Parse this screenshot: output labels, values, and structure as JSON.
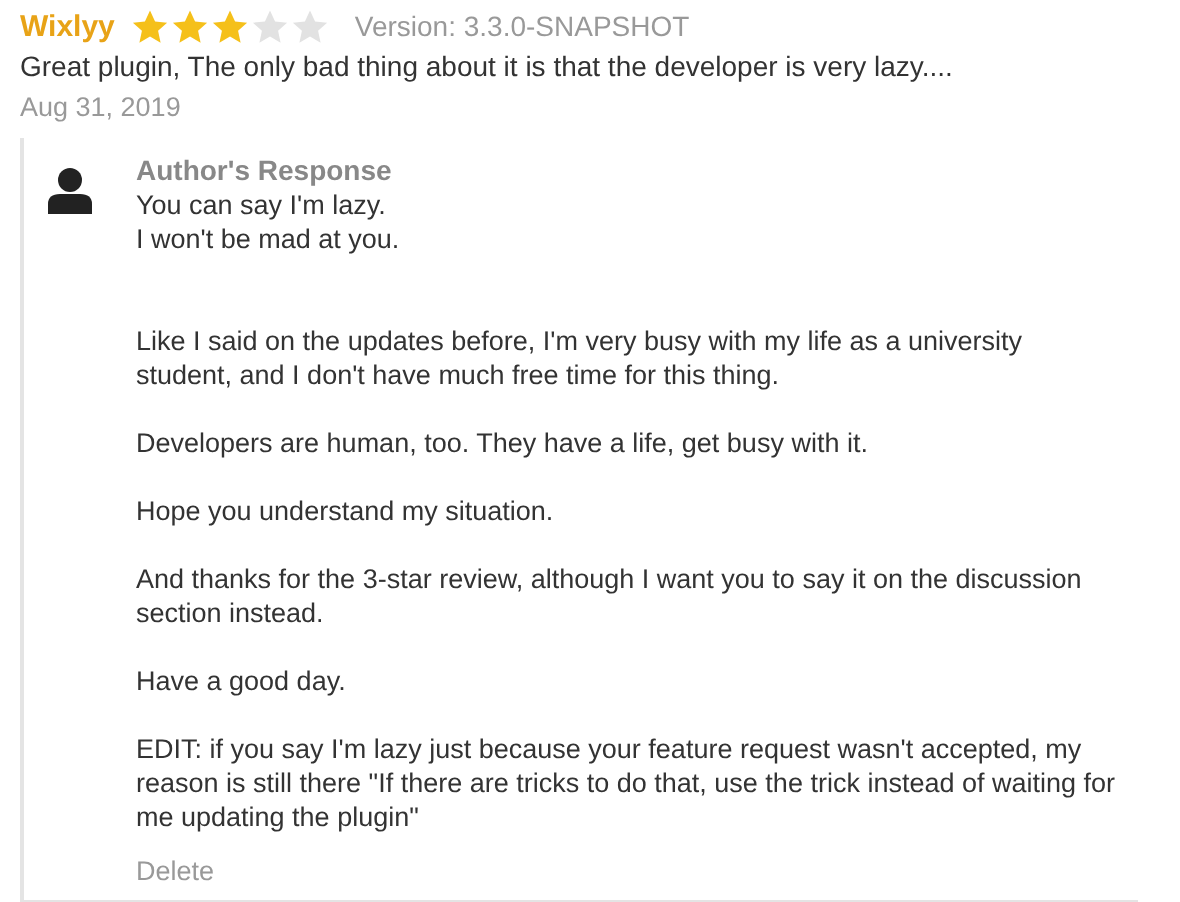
{
  "review": {
    "author": "Wixlyy",
    "stars": 3,
    "version": "Version: 3.3.0-SNAPSHOT",
    "text": "Great plugin, The only bad thing about it is that the developer is very lazy....",
    "date": "Aug 31, 2019"
  },
  "response": {
    "title": "Author's Response",
    "paragraphs": [
      "You can say I'm lazy.\nI won't be mad at you.",
      "Like I said on the updates before, I'm very busy with my life as a university student, and I don't have much free time for this thing.",
      "Developers are human, too. They have a life, get busy with it.",
      "Hope you understand my situation.",
      "And thanks for the 3-star review, although I want you to say it on the discussion section instead.",
      "Have a good day.",
      "EDIT: if you say I'm lazy just because your feature request wasn't accepted, my reason is still there \"If there are tricks to do that, use the trick instead of waiting for me updating the plugin\""
    ],
    "delete": "Delete"
  }
}
